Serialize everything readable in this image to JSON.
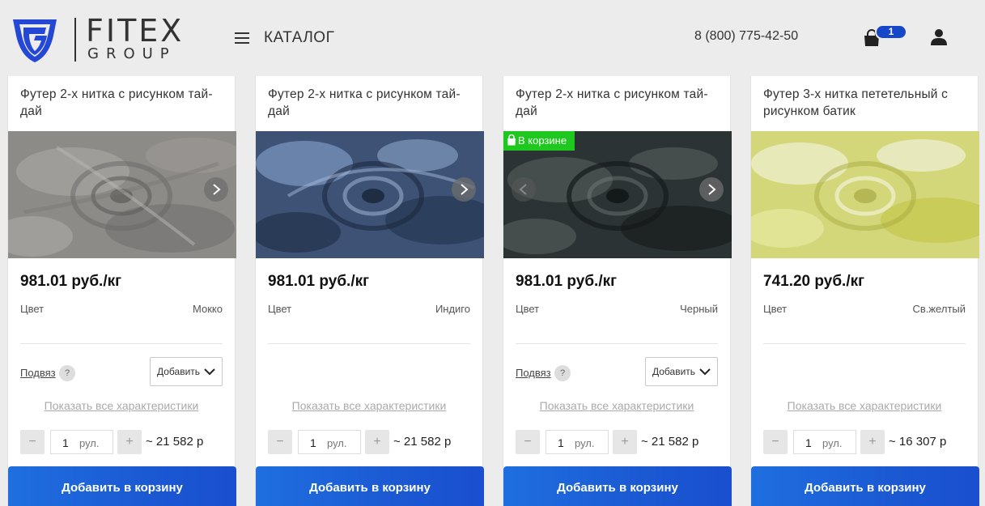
{
  "header": {
    "logo_name": "FITEX",
    "logo_sub": "GROUP",
    "catalog_label": "КАТАЛОГ",
    "phone": "8 (800) 775-42-50",
    "cart_count": "1"
  },
  "colors": {
    "accent": "#1a5ad6",
    "in_cart_green": "#1ec81e",
    "badge_blue": "#1747c9"
  },
  "products": [
    {
      "title": "Футер 2-х нитка с рисунком тай-дай",
      "price": "981.01 руб./кг",
      "color_label": "Цвет",
      "color_value": "Мокко",
      "podvyaz_label": "Подвяз",
      "help_label": "?",
      "add_select_label": "Добавить",
      "show_all_label": "Показать все характеристики",
      "qty": "1",
      "unit": "рул.",
      "total": "~ 21 582 р",
      "add_to_cart_label": "Добавить в корзину"
    },
    {
      "title": "Футер 2-х нитка с рисунком тай-дай",
      "price": "981.01 руб./кг",
      "color_label": "Цвет",
      "color_value": "Индиго",
      "show_all_label": "Показать все характеристики",
      "qty": "1",
      "unit": "рул.",
      "total": "~ 21 582 р",
      "add_to_cart_label": "Добавить в корзину"
    },
    {
      "title": "Футер 2-х нитка с рисунком тай-дай",
      "in_cart_label": "В корзине",
      "price": "981.01 руб./кг",
      "color_label": "Цвет",
      "color_value": "Черный",
      "podvyaz_label": "Подвяз",
      "help_label": "?",
      "add_select_label": "Добавить",
      "show_all_label": "Показать все характеристики",
      "qty": "1",
      "unit": "рул.",
      "total": "~ 21 582 р",
      "add_to_cart_label": "Добавить в корзину"
    },
    {
      "title": "Футер 3-х нитка пететельный с рисунком батик",
      "price": "741.20 руб./кг",
      "color_label": "Цвет",
      "color_value": "Св.желтый",
      "show_all_label": "Показать все характеристики",
      "qty": "1",
      "unit": "рул.",
      "total": "~ 16 307 р",
      "add_to_cart_label": "Добавить в корзину"
    }
  ],
  "qty_controls": {
    "minus": "−",
    "plus": "+"
  }
}
